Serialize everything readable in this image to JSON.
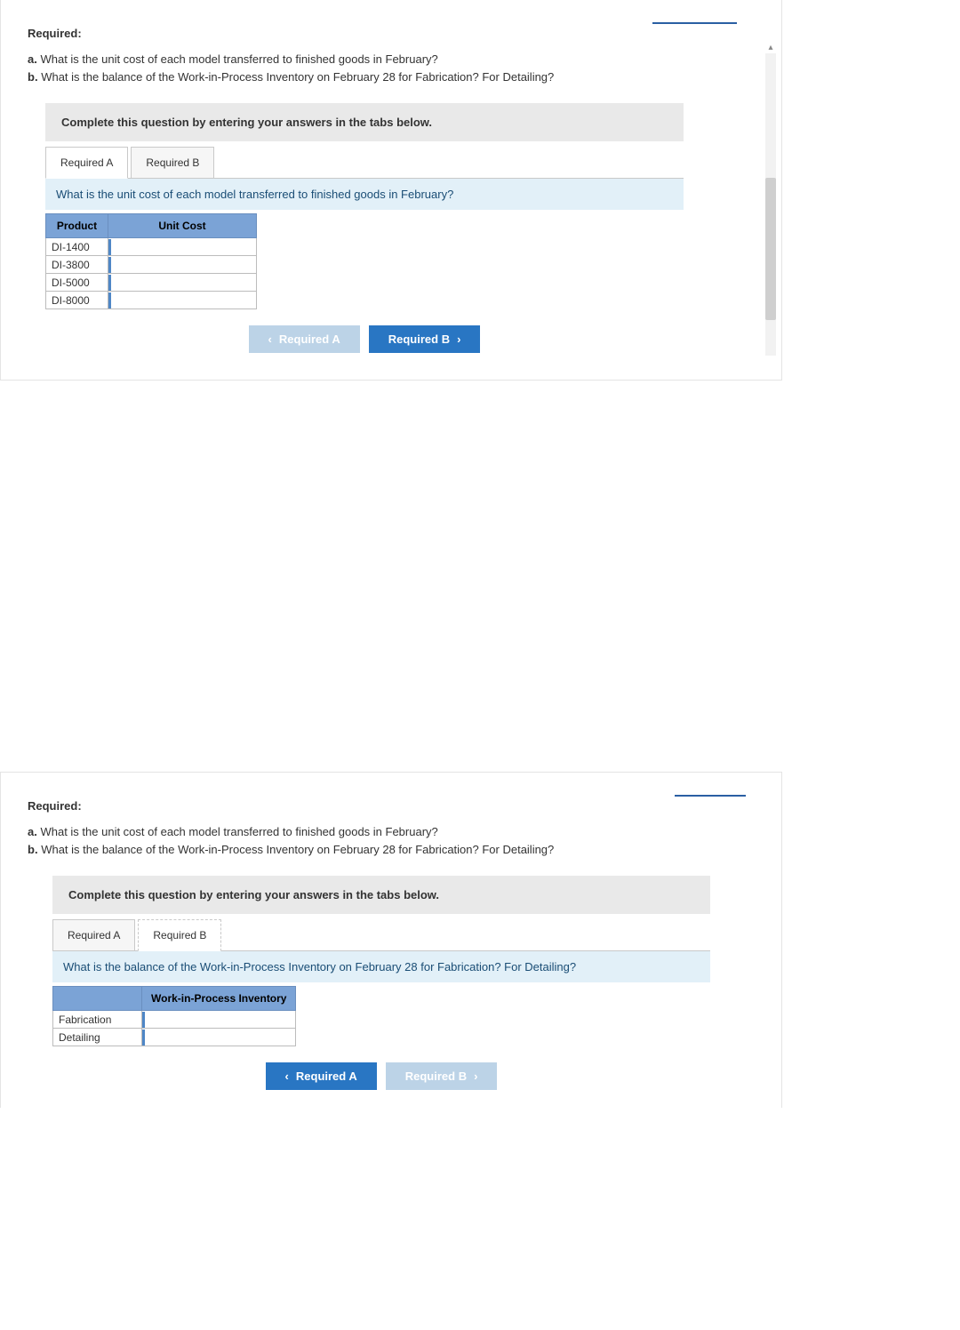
{
  "section1": {
    "required_heading": "Required:",
    "items": [
      {
        "letter": "a.",
        "text": "What is the unit cost of each model transferred to finished goods in February?"
      },
      {
        "letter": "b.",
        "text": "What is the balance of the Work-in-Process Inventory on February 28 for Fabrication? For Detailing?"
      }
    ],
    "instruction": "Complete this question by entering your answers in the tabs below.",
    "tabs": {
      "a": "Required A",
      "b": "Required B"
    },
    "question_bar": "What is the unit cost of each model transferred to finished goods in February?",
    "table": {
      "headers": [
        "Product",
        "Unit Cost"
      ],
      "rows": [
        "DI-1400",
        "DI-3800",
        "DI-5000",
        "DI-8000"
      ]
    },
    "nav": {
      "prev": "Required A",
      "next": "Required B"
    }
  },
  "section2": {
    "required_heading": "Required:",
    "items": [
      {
        "letter": "a.",
        "text": "What is the unit cost of each model transferred to finished goods in February?"
      },
      {
        "letter": "b.",
        "text": "What is the balance of the Work-in-Process Inventory on February 28 for Fabrication? For Detailing?"
      }
    ],
    "instruction": "Complete this question by entering your answers in the tabs below.",
    "tabs": {
      "a": "Required A",
      "b": "Required B"
    },
    "question_bar": "What is the balance of the Work-in-Process Inventory on February 28 for Fabrication? For Detailing?",
    "table": {
      "headers": [
        "",
        "Work-in-Process Inventory"
      ],
      "rows": [
        "Fabrication",
        "Detailing"
      ]
    },
    "nav": {
      "prev": "Required A",
      "next": "Required B"
    }
  }
}
